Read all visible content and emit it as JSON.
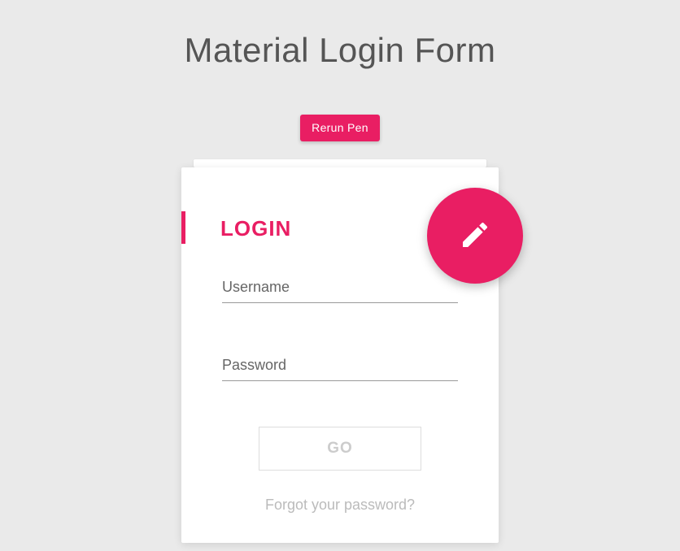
{
  "page": {
    "title": "Material Login Form"
  },
  "actions": {
    "rerun": "Rerun Pen"
  },
  "login": {
    "heading": "LOGIN",
    "username_label": "Username",
    "username_value": "",
    "password_label": "Password",
    "password_value": "",
    "submit_label": "GO",
    "forgot_label": "Forgot your password?"
  },
  "fab": {
    "icon": "pencil-icon"
  },
  "colors": {
    "accent": "#e91e63",
    "background": "#eaeaea"
  }
}
